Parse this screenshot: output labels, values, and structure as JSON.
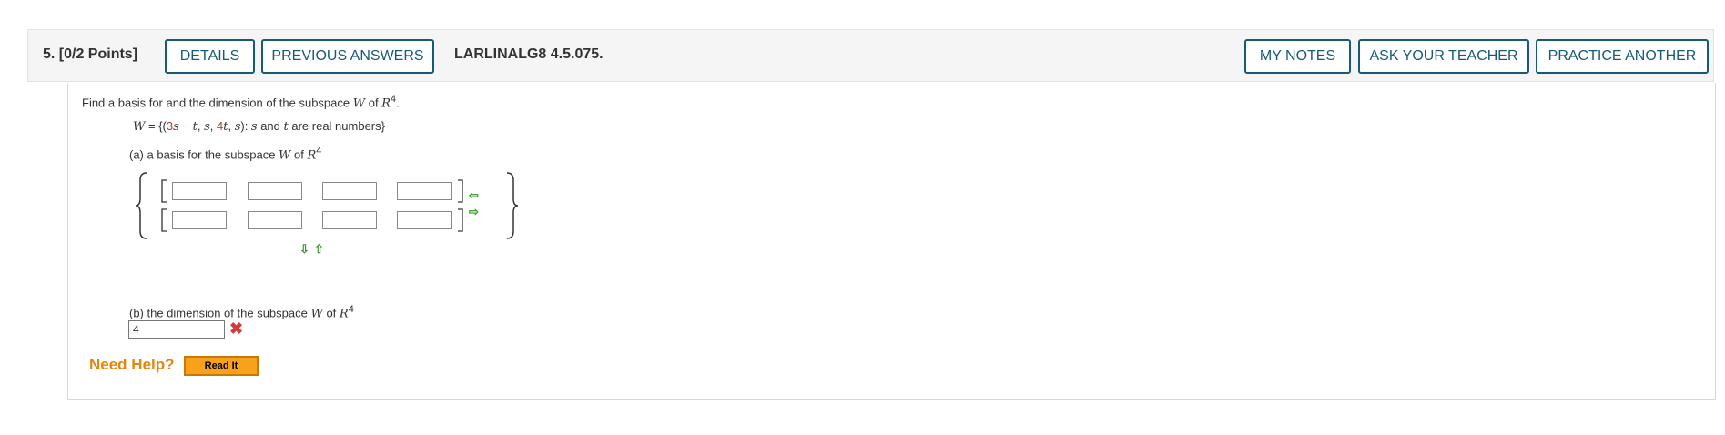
{
  "header": {
    "question_label": "5. [0/2 Points]",
    "details_label": "DETAILS",
    "previous_answers_label": "PREVIOUS ANSWERS",
    "reference": "LARLINALG8 4.5.075.",
    "my_notes_label": "MY NOTES",
    "ask_teacher_label": "ASK YOUR TEACHER",
    "practice_another_label": "PRACTICE ANOTHER"
  },
  "problem": {
    "prompt_start": "Find a basis for and the dimension of the subspace ",
    "prompt_var": "W",
    "prompt_of": " of ",
    "prompt_space": "R",
    "prompt_exp": "4",
    "prompt_end": ".",
    "set_lhs": "W",
    "set_eq": " = {(",
    "set_a": "3",
    "set_s1": "s",
    "set_minus": " − ",
    "set_t1": "t",
    "set_comma1": ", ",
    "set_s2": "s",
    "set_comma2": ", ",
    "set_b": "4",
    "set_t2": "t",
    "set_comma3": ", ",
    "set_s3": "s",
    "set_close": "): ",
    "set_s4": "s",
    "set_and": " and ",
    "set_t3": "t",
    "set_rest": " are real numbers}"
  },
  "part_a": {
    "label_start": "(a) a basis for the subspace ",
    "label_var": "W",
    "label_of": " of ",
    "label_space": "R",
    "label_exp": "4",
    "row1": [
      "",
      "",
      "",
      ""
    ],
    "row2": [
      "",
      "",
      "",
      ""
    ]
  },
  "part_b": {
    "label_start": "(b) the dimension of the subspace ",
    "label_var": "W",
    "label_of": " of ",
    "label_space": "R",
    "label_exp": "4",
    "answer": "4"
  },
  "help": {
    "need_help": "Need Help?",
    "read_it": "Read It"
  }
}
